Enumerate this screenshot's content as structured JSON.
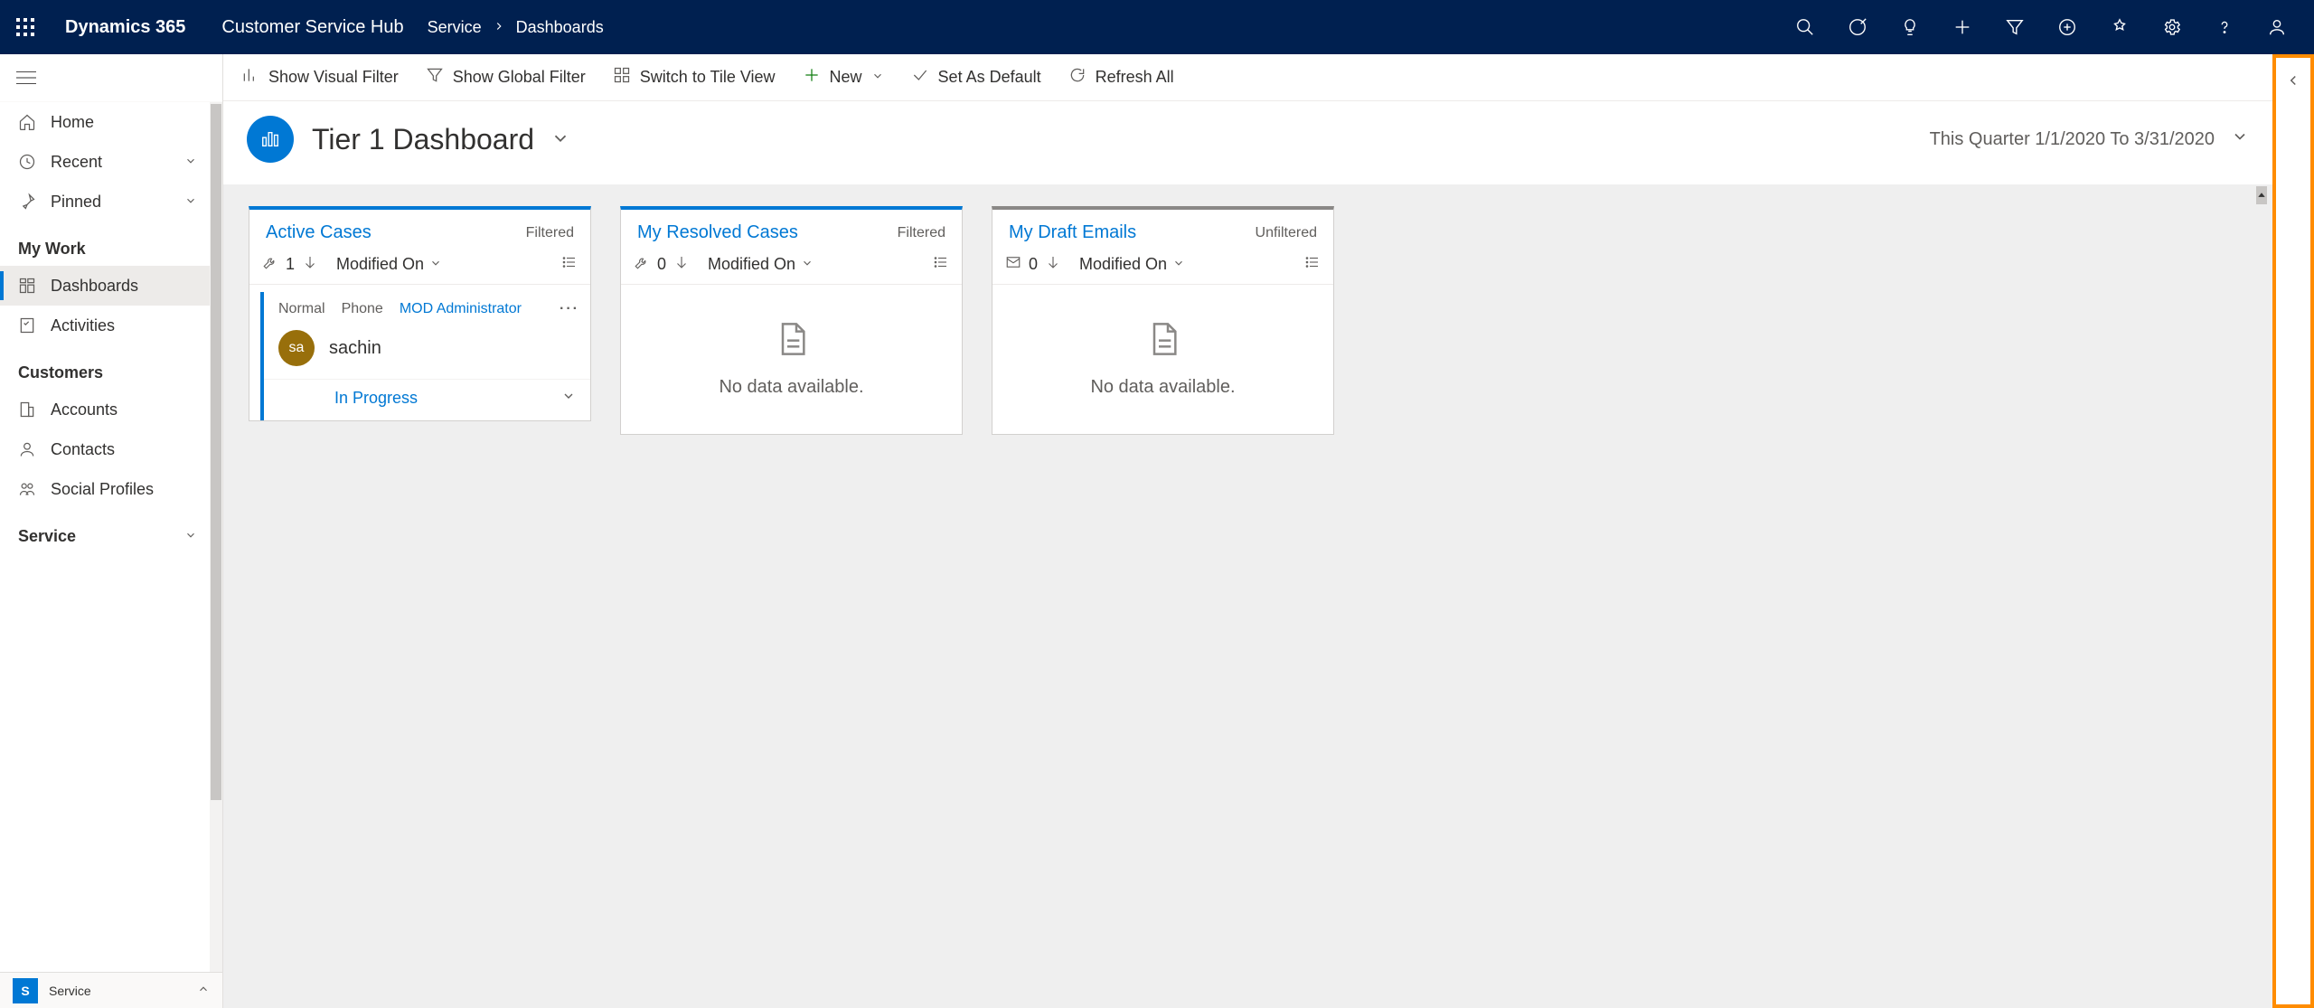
{
  "top": {
    "brand": "Dynamics 365",
    "app": "Customer Service Hub",
    "breadcrumb": {
      "area": "Service",
      "page": "Dashboards"
    }
  },
  "sidebar": {
    "home": "Home",
    "recent": "Recent",
    "pinned": "Pinned",
    "groups": {
      "mywork": {
        "label": "My Work",
        "items": [
          "Dashboards",
          "Activities"
        ]
      },
      "customers": {
        "label": "Customers",
        "items": [
          "Accounts",
          "Contacts",
          "Social Profiles"
        ]
      },
      "service": {
        "label": "Service"
      }
    },
    "area_switch": {
      "letter": "S",
      "label": "Service"
    }
  },
  "commands": {
    "visualFilter": "Show Visual Filter",
    "globalFilter": "Show Global Filter",
    "tileView": "Switch to Tile View",
    "new": "New",
    "setDefault": "Set As Default",
    "refreshAll": "Refresh All"
  },
  "dashboard": {
    "title": "Tier 1 Dashboard",
    "range": "This Quarter 1/1/2020 To 3/31/2020"
  },
  "cards": {
    "active": {
      "title": "Active Cases",
      "filter": "Filtered",
      "count": "1",
      "sort": "Modified On",
      "item": {
        "priority": "Normal",
        "origin": "Phone",
        "owner": "MOD Administrator",
        "avatar": "sa",
        "name": "sachin",
        "status": "In Progress"
      }
    },
    "resolved": {
      "title": "My Resolved Cases",
      "filter": "Filtered",
      "count": "0",
      "sort": "Modified On",
      "empty": "No data available."
    },
    "drafts": {
      "title": "My Draft Emails",
      "filter": "Unfiltered",
      "count": "0",
      "sort": "Modified On",
      "empty": "No data available."
    }
  }
}
